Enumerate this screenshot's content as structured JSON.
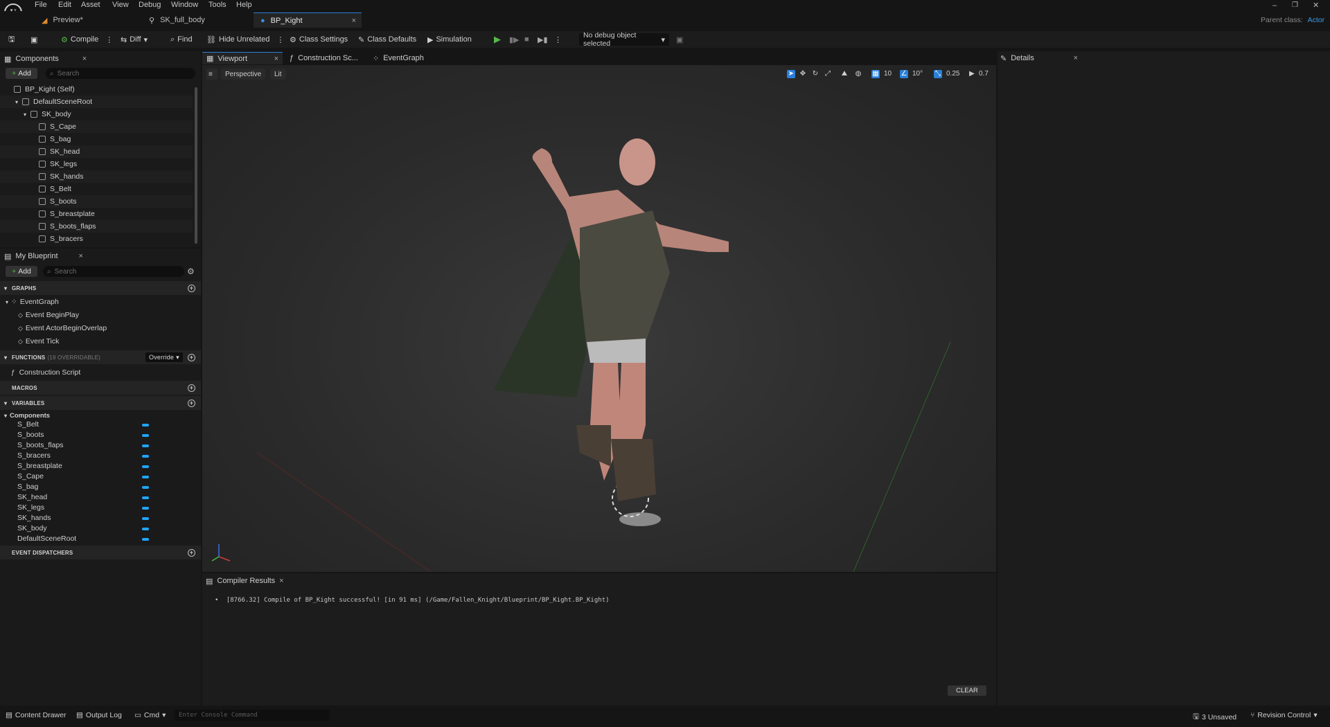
{
  "menu": [
    "File",
    "Edit",
    "Asset",
    "View",
    "Debug",
    "Window",
    "Tools",
    "Help"
  ],
  "window_controls": {
    "minimize": "–",
    "restore": "❐",
    "close": "✕"
  },
  "doc_tabs": [
    {
      "label": "Preview*"
    },
    {
      "label": "SK_full_body"
    },
    {
      "label": "BP_Kight"
    }
  ],
  "doc_tab_close": "×",
  "parent_class": {
    "label": "Parent class:",
    "value": "Actor"
  },
  "toolbar": {
    "compile": "Compile",
    "diff": "Diff",
    "find": "Find",
    "hide_unrelated": "Hide Unrelated",
    "class_settings": "Class Settings",
    "class_defaults": "Class Defaults",
    "simulation": "Simulation",
    "debug_object": "No debug object selected"
  },
  "components_panel": {
    "title": "Components",
    "add": "Add",
    "search_placeholder": "Search",
    "tree": [
      {
        "label": "BP_Kight (Self)",
        "indent": 0
      },
      {
        "label": "DefaultSceneRoot",
        "indent": 1
      },
      {
        "label": "SK_body",
        "indent": 2
      },
      {
        "label": "S_Cape",
        "indent": 3
      },
      {
        "label": "S_bag",
        "indent": 3
      },
      {
        "label": "SK_head",
        "indent": 3
      },
      {
        "label": "SK_legs",
        "indent": 3
      },
      {
        "label": "SK_hands",
        "indent": 3
      },
      {
        "label": "S_Belt",
        "indent": 3
      },
      {
        "label": "S_boots",
        "indent": 3
      },
      {
        "label": "S_breastplate",
        "indent": 3
      },
      {
        "label": "S_boots_flaps",
        "indent": 3
      },
      {
        "label": "S_bracers",
        "indent": 3
      }
    ]
  },
  "my_blueprint": {
    "title": "My Blueprint",
    "add": "Add",
    "search_placeholder": "Search",
    "graphs_header": "GRAPHS",
    "eventgraph": "EventGraph",
    "events": [
      "Event BeginPlay",
      "Event ActorBeginOverlap",
      "Event Tick"
    ],
    "functions_header": "FUNCTIONS",
    "functions_count": "(19 OVERRIDABLE)",
    "override": "Override",
    "construction_script": "Construction Script",
    "macros_header": "MACROS",
    "variables_header": "VARIABLES",
    "components_group": "Components",
    "variables": [
      "S_Belt",
      "S_boots",
      "S_boots_flaps",
      "S_bracers",
      "S_breastplate",
      "S_Cape",
      "S_bag",
      "SK_head",
      "SK_legs",
      "SK_hands",
      "SK_body",
      "DefaultSceneRoot"
    ],
    "dispatchers_header": "EVENT DISPATCHERS"
  },
  "editor_tabs": [
    "Viewport",
    "Construction Sc...",
    "EventGraph"
  ],
  "viewport": {
    "perspective": "Perspective",
    "lit": "Lit",
    "grid_snap": "10",
    "rot_snap": "10°",
    "scale_snap": "0.25",
    "cam_speed": "0.7"
  },
  "details": {
    "title": "Details"
  },
  "compiler": {
    "title": "Compiler Results",
    "message": "[8766.32] Compile of BP_Kight successful! [in 91 ms] (/Game/Fallen_Knight/Blueprint/BP_Kight.BP_Kight)",
    "clear": "CLEAR"
  },
  "statusbar": {
    "content_drawer": "Content Drawer",
    "output_log": "Output Log",
    "cmd": "Cmd",
    "console_placeholder": "Enter Console Command",
    "unsaved": "3 Unsaved",
    "revision": "Revision Control"
  },
  "colors": {
    "accent": "#2a7fd8",
    "play": "#56b94a",
    "var_pill": "#1fa6ff"
  }
}
